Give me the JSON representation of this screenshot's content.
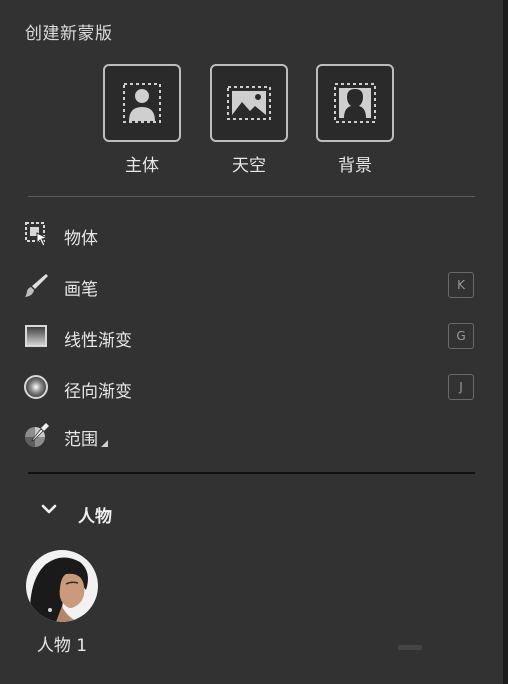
{
  "panel": {
    "title": "创建新蒙版",
    "accent": "#bdbdbd",
    "background": "#323232"
  },
  "quick_masks": [
    {
      "label": "主体",
      "icon": "select-subject-icon"
    },
    {
      "label": "天空",
      "icon": "select-sky-icon"
    },
    {
      "label": "背景",
      "icon": "select-background-icon"
    }
  ],
  "tools": [
    {
      "label": "物体",
      "icon": "object-select-icon",
      "shortcut": ""
    },
    {
      "label": "画笔",
      "icon": "brush-icon",
      "shortcut": "K"
    },
    {
      "label": "线性渐变",
      "icon": "linear-gradient-icon",
      "shortcut": "G"
    },
    {
      "label": "径向渐变",
      "icon": "radial-gradient-icon",
      "shortcut": "J"
    },
    {
      "label": "范围",
      "icon": "range-eyedropper-icon",
      "shortcut": ""
    }
  ],
  "group": {
    "name": "人物",
    "expanded": true,
    "items": [
      {
        "label": "人物 1",
        "icon": "person-thumbnail"
      }
    ]
  }
}
